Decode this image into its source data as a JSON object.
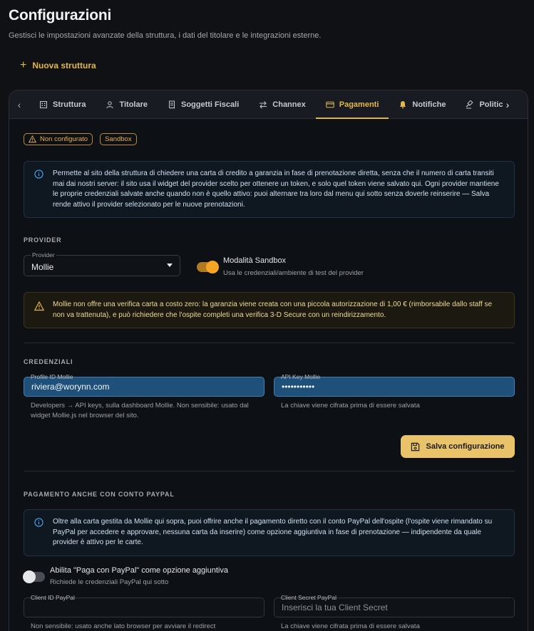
{
  "page": {
    "title": "Configurazioni",
    "subtitle": "Gestisci le impostazioni avanzate della struttura, i dati del titolare e le integrazioni esterne.",
    "new_button": "Nuova struttura"
  },
  "tabs": [
    {
      "label": "Struttura",
      "icon": "building-icon"
    },
    {
      "label": "Titolare",
      "icon": "user-icon"
    },
    {
      "label": "Soggetti Fiscali",
      "icon": "receipt-icon"
    },
    {
      "label": "Channex",
      "icon": "swap-arrows-icon"
    },
    {
      "label": "Pagamenti",
      "icon": "credit-card-icon",
      "active": true
    },
    {
      "label": "Notifiche",
      "icon": "bell-icon"
    },
    {
      "label": "Politic",
      "icon": "gavel-icon"
    }
  ],
  "badges": {
    "not_configured": "Non configurato",
    "sandbox": "Sandbox"
  },
  "info_main": "Permette al sito della struttura di chiedere una carta di credito a garanzia in fase di prenotazione diretta, senza che il numero di carta transiti mai dai nostri server: il sito usa il widget del provider scelto per ottenere un token, e solo quel token viene salvato qui. Ogni provider mantiene le proprie credenziali salvate anche quando non è quello attivo: puoi alternare tra loro dal menu qui sotto senza doverle reinserire — Salva rende attivo il provider selezionato per le nuove prenotazioni.",
  "provider": {
    "section": "PROVIDER",
    "label": "Provider",
    "value": "Mollie",
    "sandbox_title": "Modalità Sandbox",
    "sandbox_sub": "Usa le credenziali/ambiente di test del provider",
    "sandbox_on": true
  },
  "warning": "Mollie non offre una verifica carta a costo zero: la garanzia viene creata con una piccola autorizzazione di 1,00 € (rimborsabile dallo staff se non va trattenuta), e può richiedere che l'ospite completi una verifica 3-D Secure con un reindirizzamento.",
  "credentials": {
    "section": "CREDENZIALI",
    "profile_label": "Profile ID Mollie",
    "profile_value": "riviera@worynn.com",
    "profile_help": "Developers → API keys, sulla dashboard Mollie. Non sensibile: usato dal widget Mollie.js nel browser del sito.",
    "apikey_label": "API Key Mollie",
    "apikey_value": "•••••••••••",
    "apikey_help": "La chiave viene cifrata prima di essere salvata",
    "save_button": "Salva configurazione"
  },
  "paypal": {
    "section": "PAGAMENTO ANCHE CON CONTO PAYPAL",
    "info": "Oltre alla carta gestita da Mollie qui sopra, puoi offrire anche il pagamento diretto con il conto PayPal dell'ospite (l'ospite viene rimandato su PayPal per accedere e approvare, nessuna carta da inserire) come opzione aggiuntiva in fase di prenotazione — indipendente da quale provider è attivo per le carte.",
    "toggle_title": "Abilita \"Paga con PayPal\" come opzione aggiuntiva",
    "toggle_sub": "Richiede le credenziali PayPal qui sotto",
    "toggle_on": false,
    "client_id_label": "Client ID PayPal",
    "client_id_value": "",
    "client_id_help": "Non sensibile: usato anche lato browser per avviare il redirect",
    "client_secret_label": "Client Secret PayPal",
    "client_secret_placeholder": "Inserisci la tua Client Secret",
    "client_secret_help": "La chiave viene cifrata prima di essere salvata"
  },
  "colors": {
    "accent": "#e2b84b",
    "background": "#101114",
    "input_filled": "#1e5079"
  }
}
